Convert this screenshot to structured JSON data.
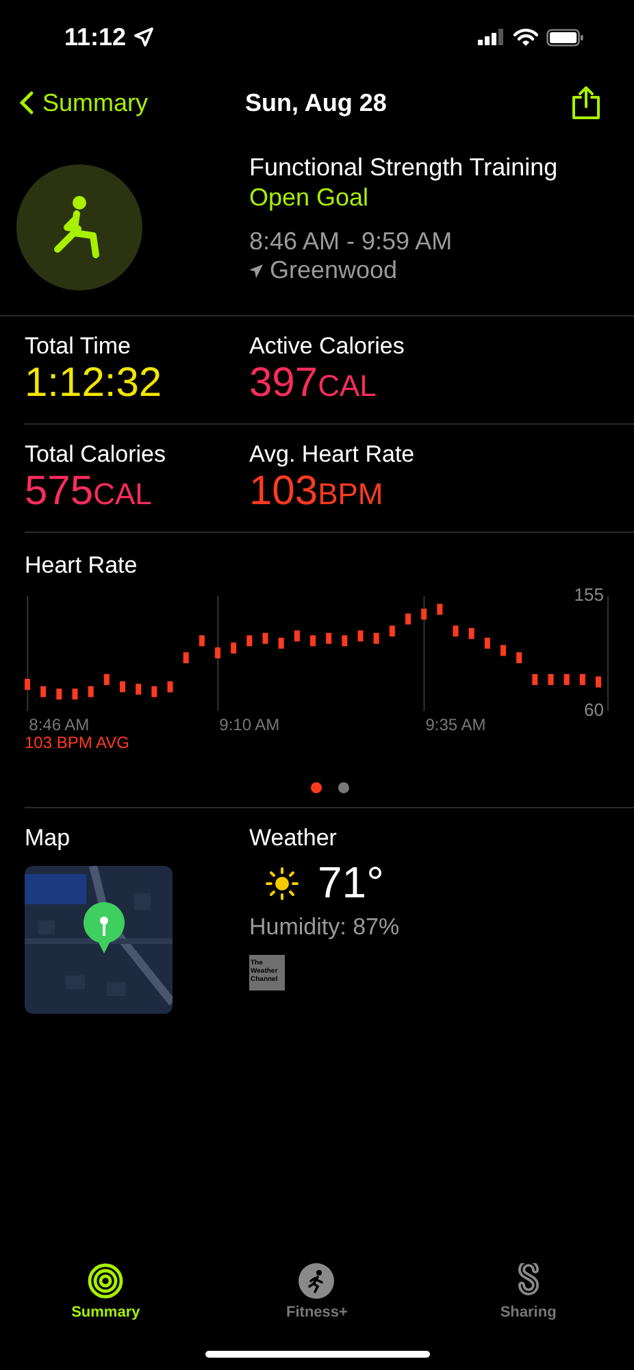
{
  "status_bar": {
    "time": "11:12"
  },
  "nav": {
    "back": "Summary",
    "title": "Sun, Aug 28"
  },
  "workout": {
    "name": "Functional Strength Training",
    "goal": "Open Goal",
    "time_range": "8:46 AM - 9:59 AM",
    "location": "Greenwood"
  },
  "metrics": [
    {
      "label": "Total Time",
      "value": "1:12:32",
      "color": "#f3e600"
    },
    {
      "label": "Active Calories",
      "value": "397",
      "unit": "CAL",
      "color": "#fa2d5a"
    },
    {
      "label": "Total Calories",
      "value": "575",
      "unit": "CAL",
      "color": "#fa2d5a"
    },
    {
      "label": "Avg. Heart Rate",
      "value": "103",
      "unit": "BPM",
      "color": "#ff3b1f"
    }
  ],
  "heart_rate": {
    "average": "103 BPM AVG",
    "chart_data": {
      "type": "scatter",
      "title": "Heart Rate",
      "categories": [
        null,
        null,
        "8:46 AM",
        null,
        null,
        null,
        null,
        null,
        null,
        null,
        null,
        null,
        null,
        null,
        "9:10 AM",
        null,
        null,
        null,
        null,
        null,
        null,
        null,
        null,
        null,
        null,
        null,
        null,
        "9:35 AM",
        null,
        null,
        null,
        null,
        null,
        null,
        null,
        null,
        null
      ],
      "series": [
        {
          "color": "#ff3b1f",
          "values": [
            82,
            76,
            74,
            74,
            76,
            86,
            80,
            78,
            76,
            80,
            104,
            118,
            108,
            112,
            118,
            120,
            116,
            122,
            118,
            120,
            118,
            122,
            120,
            126,
            136,
            140,
            144,
            126,
            124,
            116,
            110,
            104,
            86,
            86,
            86,
            86,
            84
          ]
        }
      ],
      "ylim": [
        60,
        155
      ],
      "yticks": [
        60,
        155
      ],
      "grid": true
    }
  },
  "pages": [
    {
      "selected": true
    },
    {
      "selected": false
    }
  ],
  "map": {
    "title": "Map",
    "kind": "picture"
  },
  "weather": {
    "title": "Weather",
    "temperature": "71°",
    "humidity": "Humidity: 87%",
    "logo_text": "The Weather Channel"
  },
  "tabs": [
    {
      "label": "Summary",
      "selected": true
    },
    {
      "label": "Fitness+",
      "selected": false
    },
    {
      "label": "Sharing",
      "selected": false
    }
  ]
}
